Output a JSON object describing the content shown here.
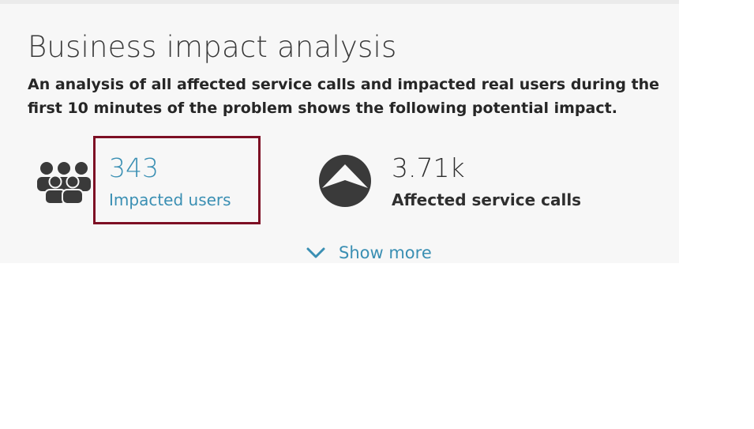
{
  "section": {
    "title": "Business impact analysis",
    "description": "An analysis of all affected service calls and impacted real users during the first 10 minutes of the problem shows the following potential impact."
  },
  "metrics": {
    "impacted_users": {
      "value": "343",
      "label": "Impacted users",
      "icon": "users-group-icon",
      "color": "#3a8fb3"
    },
    "affected_calls": {
      "value": "3.71k",
      "label": "Affected service calls",
      "icon": "service-calls-icon",
      "color": "#2f2f2f"
    }
  },
  "actions": {
    "show_more_label": "Show more",
    "show_more_icon": "chevron-down-icon"
  },
  "colors": {
    "accent": "#3a8fb3",
    "highlight_border": "#7d0f24",
    "panel_background": "#f7f7f7"
  }
}
